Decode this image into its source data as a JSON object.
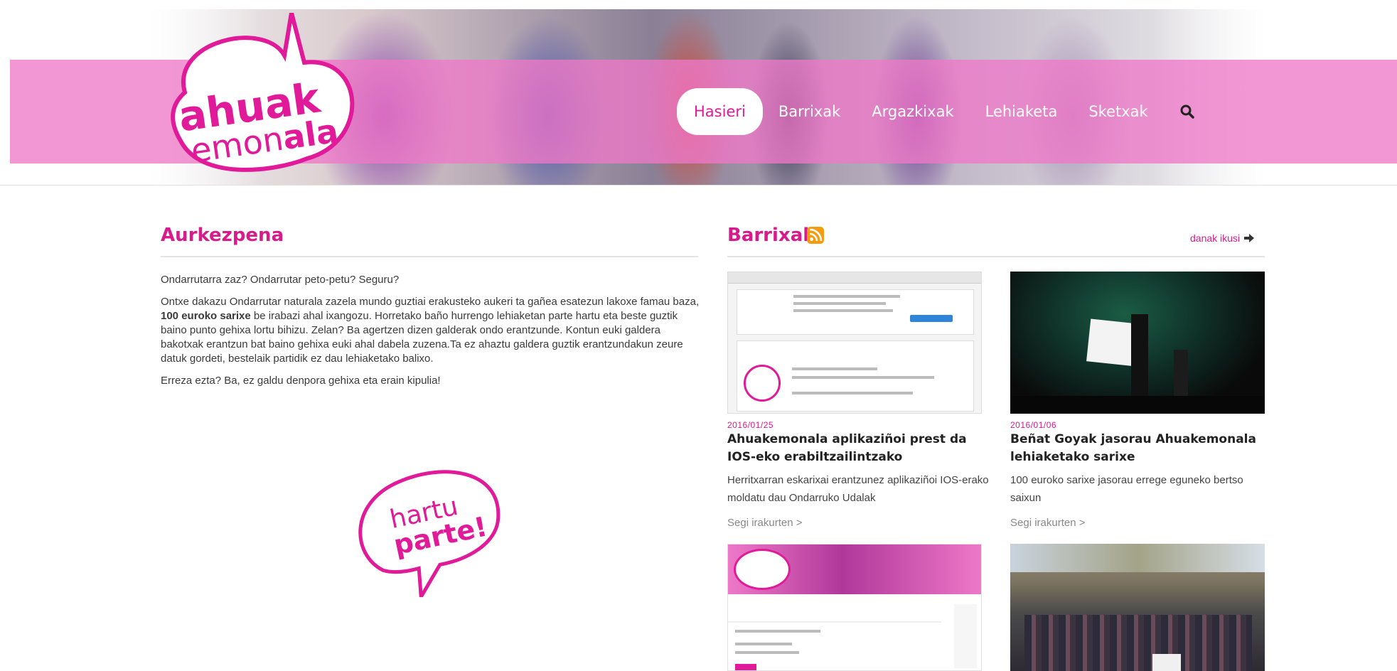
{
  "site": {
    "logo_alt": "ahuak emonala",
    "nav": [
      {
        "label": "Hasieri",
        "active": true
      },
      {
        "label": "Barrixak",
        "active": false
      },
      {
        "label": "Argazkixak",
        "active": false
      },
      {
        "label": "Lehiaketa",
        "active": false
      },
      {
        "label": "Sketxak",
        "active": false
      }
    ],
    "search_icon": "search-icon"
  },
  "intro": {
    "heading": "Aurkezpena",
    "p1": "Ondarrutarra zaz? Ondarrutar peto-petu? Seguru?",
    "p2_before": "Ontxe dakazu Ondarrutar naturala zazela mundo guztiai erakusteko aukeri ta gañea esatezun lakoxe famau baza, ",
    "p2_bold": "100 euroko sarixe",
    "p2_after": " be irabazi ahal ixangozu. Horretako baño hurrengo lehiaketan parte hartu eta beste guztik baino punto gehixa lortu bihizu. Zelan? Ba agertzen dizen galderak ondo erantzunde. Kontun euki galdera bakotxak erantzun bat baino gehixa euki ahal dabela zuzena.Ta ez ahaztu galdera guztik erantzundakun zeure datuk gordeti, bestelaik partidik ez dau lehiaketako balixo.",
    "p3": "Erreza ezta? Ba, ez galdu denpora gehixa eta erain kipulia!",
    "sticker_alt": "hartu parte!"
  },
  "news": {
    "heading": "Barrixak",
    "see_all": "danak ikusi",
    "read_more": "Segi irakurten >",
    "cards": [
      {
        "date": "2016/01/25",
        "title": "Ahuakemonala aplikaziñoi prest da IOS-eko erabiltzailintzako",
        "desc": "Herritxarran eskarixai erantzunez aplikaziñoi IOS-erako moldatu dau Ondarruko Udalak"
      },
      {
        "date": "2016/01/06",
        "title": "Beñat Goyak jasorau Ahuakemonala lehiaketako sarixe",
        "desc": "100 euroko sarixe jasorau errege eguneko bertso saixun"
      }
    ]
  },
  "colors": {
    "brand_pink": "#d81b8c",
    "band_pink": "#ee78c8"
  }
}
